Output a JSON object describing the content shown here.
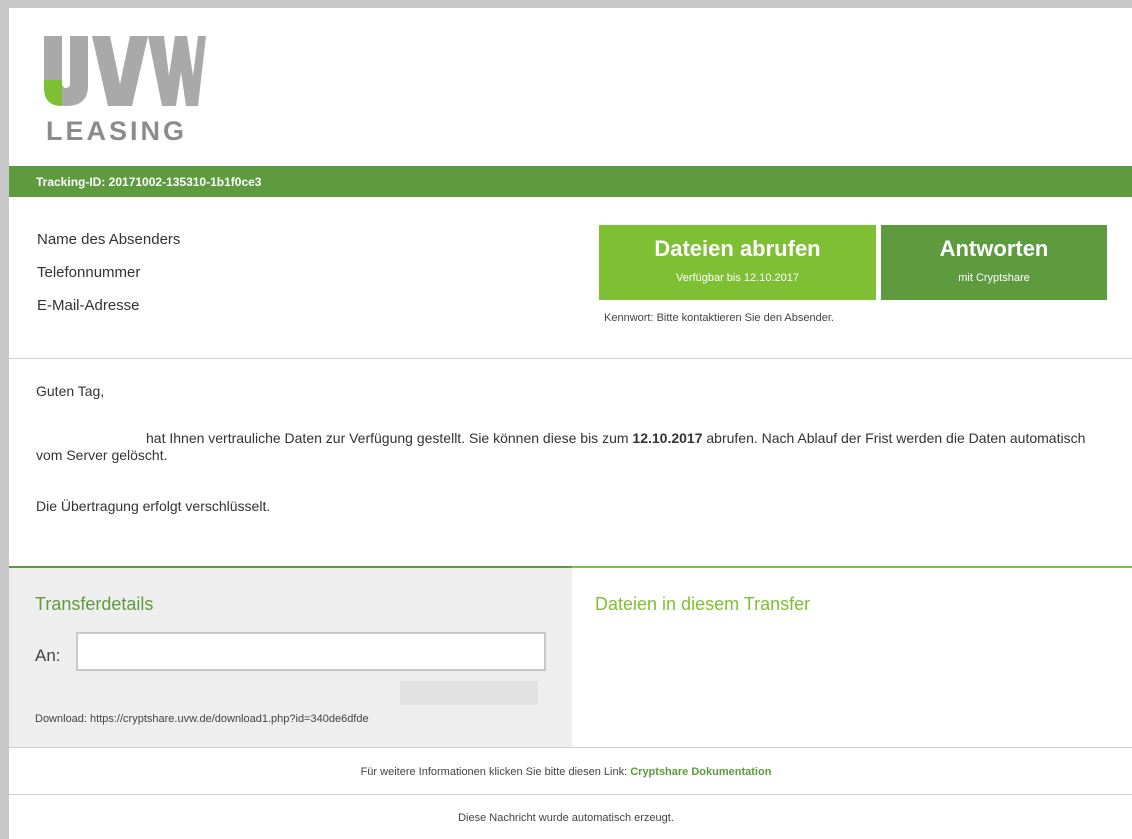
{
  "logo": {
    "text": "LEASING",
    "colors": {
      "grey": "#a9a9a9",
      "green": "#7fbf34"
    }
  },
  "tracking": {
    "label": "Tracking-ID: 20171002-135310-1b1f0ce3"
  },
  "sender": {
    "name_label": "Name des Absenders",
    "phone_label": "Telefonnummer",
    "email_label": "E-Mail-Adresse"
  },
  "actions": {
    "download": {
      "title": "Dateien abrufen",
      "subtitle": "Verfügbar bis 12.10.2017"
    },
    "reply": {
      "title": "Antworten",
      "subtitle": "mit Cryptshare"
    },
    "password_note": "Kennwort: Bitte kontaktieren Sie den Absender."
  },
  "message": {
    "greeting": "Guten Tag,",
    "p1_before": "hat Ihnen vertrauliche Daten zur Verfügung gestellt. Sie können diese bis zum ",
    "p1_date": "12.10.2017",
    "p1_after": " abrufen. Nach Ablauf der Frist werden die Daten automatisch vom Server gelöscht.",
    "p2": "Die Übertragung erfolgt verschlüsselt."
  },
  "transfer": {
    "title": "Transferdetails",
    "to_label": "An:",
    "to_value": "",
    "download_link": "Download: https://cryptshare.uvw.de/download1.php?id=340de6dfde"
  },
  "files": {
    "title": "Dateien in diesem Transfer"
  },
  "footer": {
    "info_text": "Für weitere Informationen klicken Sie bitte diesen Link: ",
    "doc_link": "Cryptshare Dokumentation",
    "auto_note": "Diese Nachricht wurde automatisch erzeugt."
  },
  "colors": {
    "accent_dark": "#5d9b3e",
    "accent_light": "#7fbf34"
  }
}
